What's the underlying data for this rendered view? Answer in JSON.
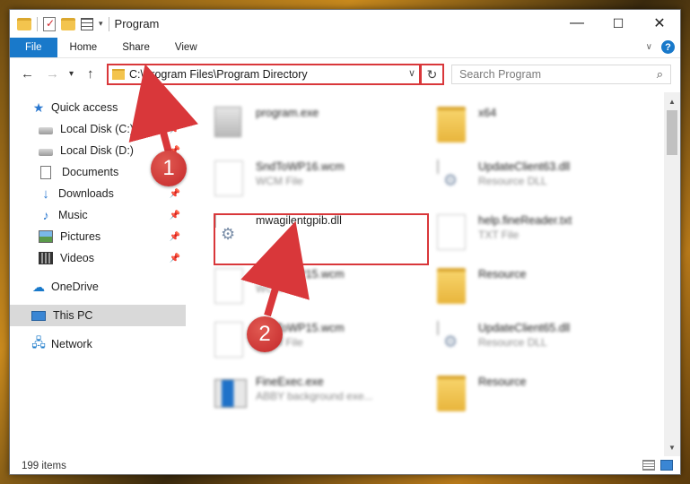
{
  "window": {
    "title": "Program",
    "controls": {
      "minimize": "—",
      "maximize": "☐",
      "close": "✕"
    }
  },
  "ribbon": {
    "tabs": [
      "File",
      "Home",
      "Share",
      "View"
    ],
    "help": "?"
  },
  "address": {
    "path": "C:\\Program Files\\Program Directory",
    "refresh": "↻",
    "search_placeholder": "Search Program"
  },
  "nav": {
    "back": "←",
    "forward": "→",
    "recent": "▾",
    "up": "↑",
    "items": [
      {
        "label": "Quick access",
        "icon": "star-icon",
        "pinned": false
      },
      {
        "label": "Local Disk (C:)",
        "icon": "disk-icon",
        "pinned": true
      },
      {
        "label": "Local Disk (D:)",
        "icon": "disk-icon",
        "pinned": true
      },
      {
        "label": "Documents",
        "icon": "documents-icon",
        "pinned": true
      },
      {
        "label": "Downloads",
        "icon": "downloads-icon",
        "pinned": true
      },
      {
        "label": "Music",
        "icon": "music-icon",
        "pinned": true
      },
      {
        "label": "Pictures",
        "icon": "pictures-icon",
        "pinned": true
      },
      {
        "label": "Videos",
        "icon": "videos-icon",
        "pinned": true
      },
      {
        "label": "OneDrive",
        "icon": "onedrive-icon",
        "pinned": false
      },
      {
        "label": "This PC",
        "icon": "pc-icon",
        "pinned": false,
        "selected": true
      },
      {
        "label": "Network",
        "icon": "network-icon",
        "pinned": false
      }
    ],
    "pin_glyph": "📌"
  },
  "files": [
    {
      "name": "program.exe",
      "type": "",
      "icon": "exe-icon"
    },
    {
      "name": "x64",
      "type": "",
      "icon": "folder-icon"
    },
    {
      "name": "SndToWP16.wcm",
      "type": "WCM File",
      "icon": "document-icon"
    },
    {
      "name": "UpdateClient63.dll",
      "type": "Resource DLL",
      "icon": "dll-icon"
    },
    {
      "name": "mwagilentgpib.dll",
      "type": "",
      "icon": "dll-icon",
      "highlighted": true
    },
    {
      "name": "help.fineReader.txt",
      "type": "TXT File",
      "icon": "document-icon"
    },
    {
      "name": "SndToWP15.wcm",
      "type": "WCM File",
      "icon": "document-icon"
    },
    {
      "name": "Resource",
      "type": "",
      "icon": "folder-icon"
    },
    {
      "name": "SndToWP15.wcm",
      "type": "WCM File",
      "icon": "document-icon"
    },
    {
      "name": "UpdateClient65.dll",
      "type": "Resource DLL",
      "icon": "dll-icon"
    },
    {
      "name": "FineExec.exe",
      "type": "ABBY background exe...",
      "icon": "exe-icon"
    },
    {
      "name": "Resource",
      "type": "",
      "icon": "folder-icon"
    }
  ],
  "status": {
    "count": "199 items"
  },
  "annotations": {
    "step1": "1",
    "step2": "2",
    "color": "#d9373a"
  }
}
